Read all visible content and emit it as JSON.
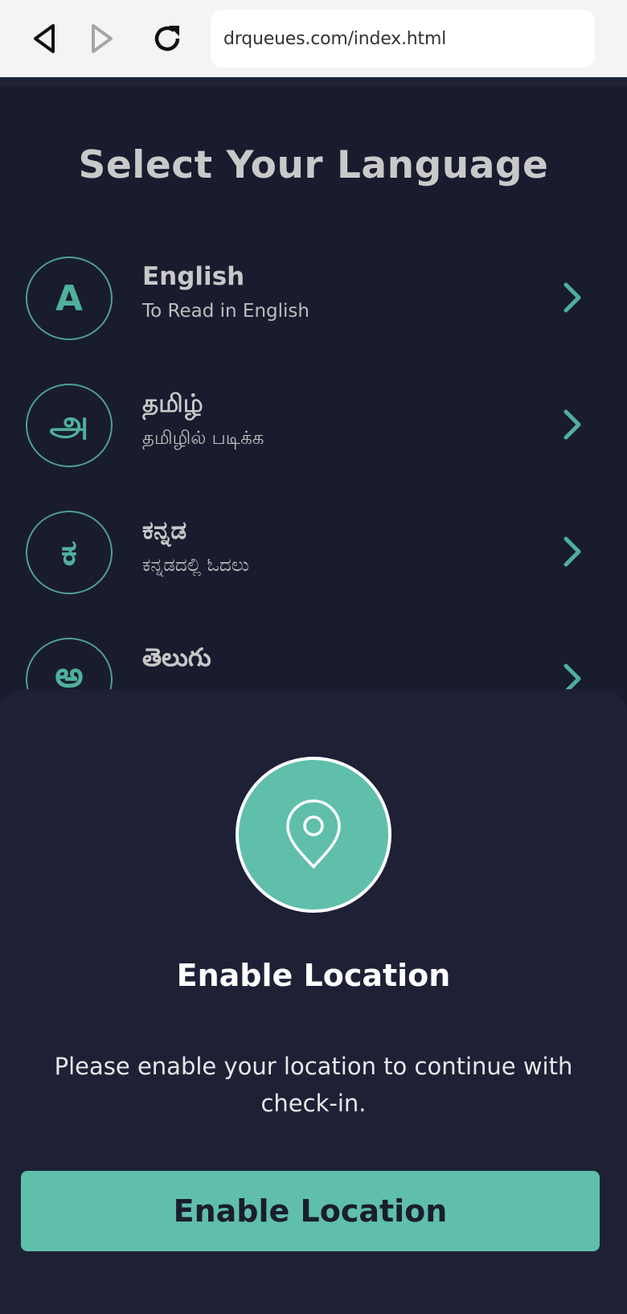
{
  "browser": {
    "url": "drqueues.com/index.html",
    "back_icon": "back-arrow-icon",
    "forward_icon": "forward-arrow-icon",
    "reload_icon": "reload-icon"
  },
  "page": {
    "title": "Select Your Language",
    "languages": [
      {
        "glyph": "A",
        "name": "English",
        "subtitle": "To Read in English"
      },
      {
        "glyph": "அ",
        "name": "தமிழ்",
        "subtitle": "தமிழில் படிக்க"
      },
      {
        "glyph": "ಕ",
        "name": "ಕನ್ನಡ",
        "subtitle": "ಕನ್ನಡದಲ್ಲಿ ಓದಲು"
      },
      {
        "glyph": "అ",
        "name": "తెలుగు",
        "subtitle": ""
      }
    ]
  },
  "sheet": {
    "icon": "location-pin-icon",
    "title": "Enable Location",
    "message": "Please enable your location to continue with check-in.",
    "button_label": "Enable Location"
  },
  "colors": {
    "background": "#191c2e",
    "sheet_background": "#1e2136",
    "accent": "#5fbfab",
    "title_text": "#c9c9c9"
  }
}
